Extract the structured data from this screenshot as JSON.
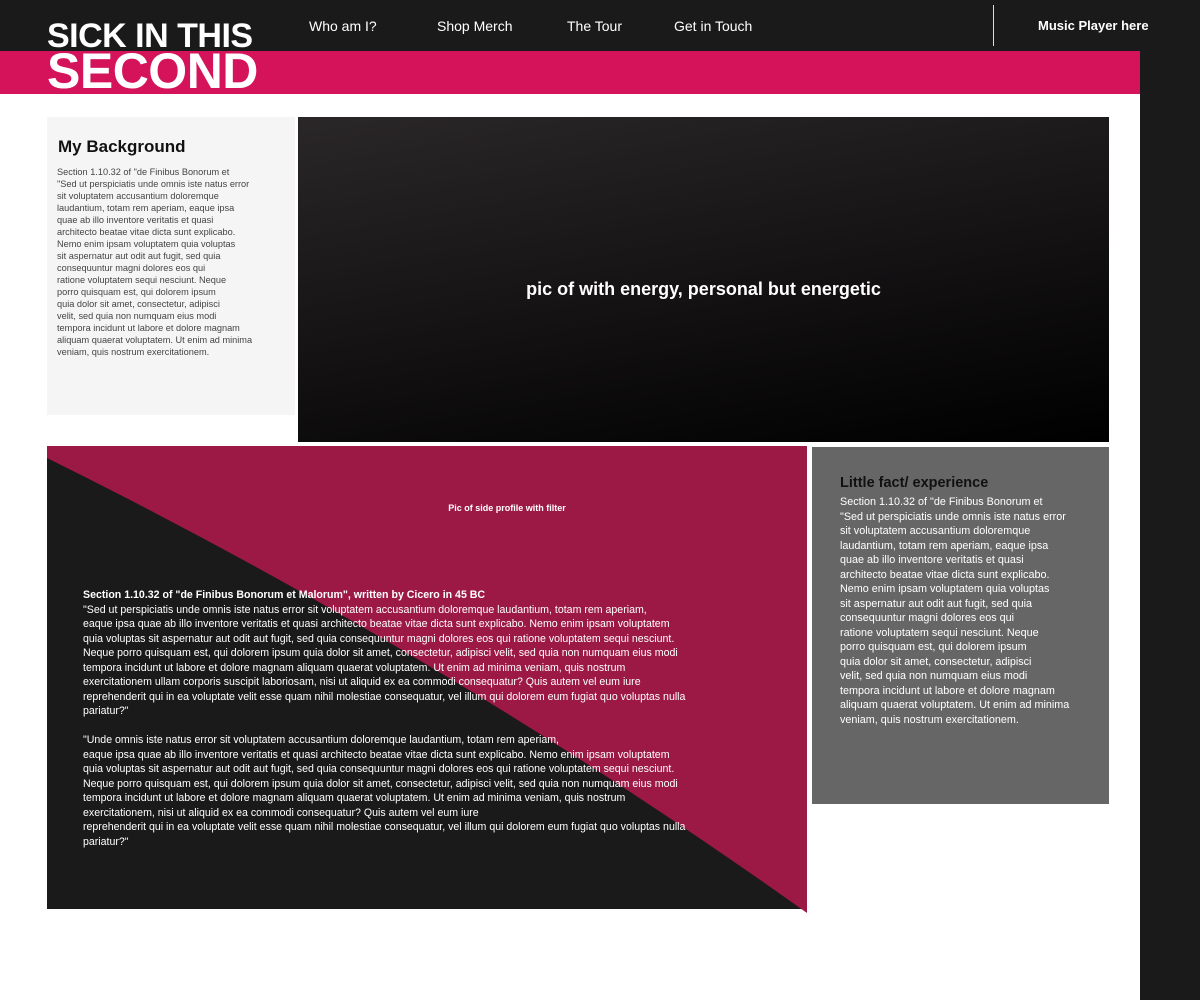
{
  "logo": {
    "line1": "SICK IN THIS",
    "line2": "SECOND"
  },
  "nav": {
    "items": [
      {
        "label": "Who am I?"
      },
      {
        "label": "Shop Merch"
      },
      {
        "label": "The Tour"
      },
      {
        "label": "Get in Touch"
      }
    ],
    "music_player": "Music Player here"
  },
  "background_card": {
    "title": "My Background",
    "body": "Section 1.10.32 of \"de Finibus Bonorum et\n\"Sed ut perspiciatis unde omnis iste natus error\n sit voluptatem accusantium doloremque\nlaudantium, totam rem aperiam, eaque ipsa\nquae ab illo inventore veritatis et quasi\narchitecto beatae vitae dicta sunt explicabo.\nNemo enim ipsam voluptatem quia voluptas\nsit aspernatur aut odit aut fugit, sed quia\nconsequuntur magni dolores eos qui\nratione voluptatem sequi nesciunt. Neque\nporro quisquam est, qui dolorem ipsum\nquia dolor sit amet, consectetur, adipisci\nvelit, sed quia non numquam eius modi\ntempora incidunt ut labore et dolore magnam\naliquam quaerat voluptatem. Ut enim ad minima\nveniam, quis nostrum exercitationem."
  },
  "hero": {
    "caption": "pic of with energy, personal but energetic"
  },
  "profile": {
    "pic_label": "Pic of side profile with filter",
    "heading": "Section 1.10.32 of \"de Finibus Bonorum et Malorum\", written by Cicero in 45 BC",
    "paragraph1": "\"Sed ut perspiciatis unde omnis iste natus error sit voluptatem accusantium doloremque laudantium, totam rem aperiam,\neaque ipsa quae ab illo inventore veritatis et quasi architecto beatae vitae dicta sunt explicabo. Nemo enim ipsam voluptatem\nquia voluptas sit aspernatur aut odit aut fugit, sed quia consequuntur magni dolores eos qui ratione voluptatem sequi nesciunt.\nNeque porro quisquam est, qui dolorem ipsum quia dolor sit amet, consectetur, adipisci velit, sed quia non numquam eius modi\ntempora incidunt ut labore et dolore magnam aliquam quaerat voluptatem. Ut enim ad minima veniam, quis nostrum\nexercitationem ullam corporis suscipit laboriosam, nisi ut aliquid ex ea commodi consequatur? Quis autem vel eum iure\nreprehenderit qui in ea voluptate velit esse quam nihil molestiae consequatur, vel illum qui dolorem eum fugiat quo voluptas nulla\npariatur?\"",
    "paragraph2": "\"Unde omnis iste natus error sit voluptatem accusantium doloremque laudantium, totam rem aperiam,\neaque ipsa quae ab illo inventore veritatis et quasi architecto beatae vitae dicta sunt explicabo. Nemo enim ipsam voluptatem\nquia voluptas sit aspernatur aut odit aut fugit, sed quia consequuntur magni dolores eos qui ratione voluptatem sequi nesciunt.\nNeque porro quisquam est, qui dolorem ipsum quia dolor sit amet, consectetur, adipisci velit, sed quia non numquam eius modi\ntempora incidunt ut labore et dolore magnam aliquam quaerat voluptatem. Ut enim ad minima veniam, quis nostrum\nexercitationem, nisi ut aliquid ex ea commodi consequatur? Quis autem vel eum iure\nreprehenderit qui in ea voluptate velit esse quam nihil molestiae consequatur, vel illum qui dolorem eum fugiat quo voluptas nulla\npariatur?\""
  },
  "fact_card": {
    "title": "Little fact/ experience",
    "body": "Section 1.10.32 of \"de Finibus Bonorum et\n\"Sed ut perspiciatis unde omnis iste natus error\n sit voluptatem accusantium doloremque\nlaudantium, totam rem aperiam, eaque ipsa\nquae ab illo inventore veritatis et quasi\narchitecto beatae vitae dicta sunt explicabo.\nNemo enim ipsam voluptatem quia voluptas\nsit aspernatur aut odit aut fugit, sed quia\nconsequuntur magni dolores eos qui\nratione voluptatem sequi nesciunt. Neque\nporro quisquam est, qui dolorem ipsum\nquia dolor sit amet, consectetur, adipisci\nvelit, sed quia non numquam eius modi\ntempora incidunt ut labore et dolore magnam\naliquam quaerat voluptatem. Ut enim ad minima\nveniam, quis nostrum exercitationem."
  },
  "colors": {
    "brand_pink": "#d4135a",
    "profile_magenta": "#9c1845",
    "dark": "#1b1a1b",
    "fact_gray": "#666666",
    "card_light": "#f5f5f5"
  }
}
